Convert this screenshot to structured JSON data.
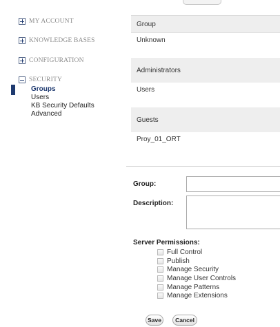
{
  "sidebar": {
    "my_account": "MY ACCOUNT",
    "knowledge_bases": "KNOWLEDGE BASES",
    "configuration": "CONFIGURATION",
    "security": "SECURITY",
    "security_items": [
      "Groups",
      "Users",
      "KB Security Defaults",
      "Advanced"
    ]
  },
  "grid": {
    "header": "Group",
    "rows": [
      "Unknown",
      "Administrators",
      "Users",
      "Guests",
      "Proy_01_ORT"
    ]
  },
  "form": {
    "group_label": "Group:",
    "group_value": "",
    "description_label": "Description:",
    "description_value": "",
    "permissions_label": "Server Permissions:",
    "permissions": [
      "Full Control",
      "Publish",
      "Manage Security",
      "Manage User Controls",
      "Manage Patterns",
      "Manage Extensions"
    ]
  },
  "buttons": {
    "save": "Save",
    "cancel": "Cancel"
  },
  "colors": {
    "accent": "#1e3a6f",
    "row_alt": "#eeeeee"
  }
}
